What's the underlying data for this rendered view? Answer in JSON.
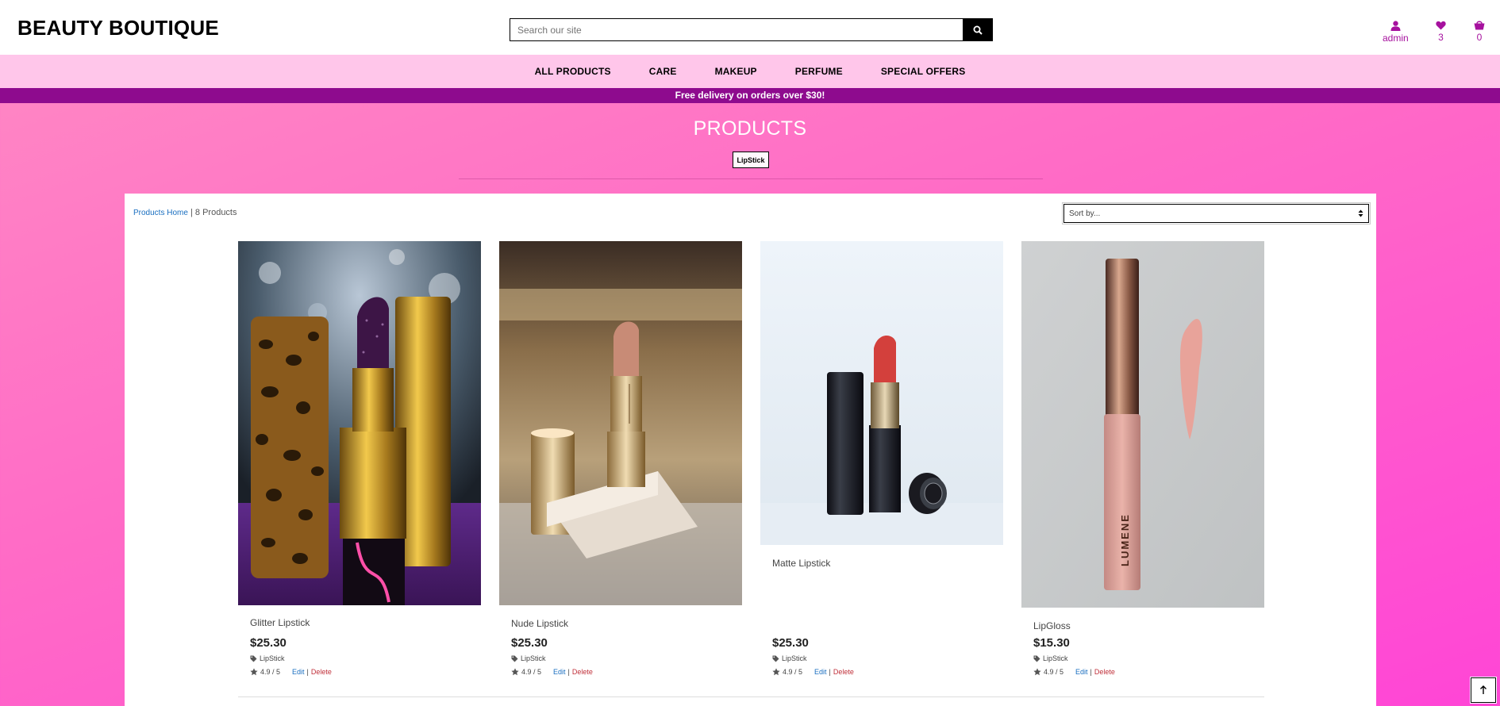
{
  "header": {
    "logo": "BEAUTY BOUTIQUE",
    "search_placeholder": "Search our site",
    "account_label": "admin",
    "wishlist_count": "3",
    "cart_count": "0"
  },
  "nav": {
    "items": [
      "ALL PRODUCTS",
      "CARE",
      "MAKEUP",
      "PERFUME",
      "SPECIAL OFFERS"
    ]
  },
  "banner": "Free delivery on orders over $30!",
  "page": {
    "title": "PRODUCTS",
    "category_badge": "LipStick"
  },
  "toolbar": {
    "breadcrumb_link": "Products Home",
    "separator": " | ",
    "product_count": "8 Products",
    "sort_placeholder": "Sort by..."
  },
  "products": [
    {
      "name": "Glitter Lipstick",
      "price": "$25.30",
      "category": "LipStick",
      "rating": "4.9 / 5",
      "edit": "Edit",
      "delete": "Delete"
    },
    {
      "name": "Nude Lipstick",
      "price": "$25.30",
      "category": "LipStick",
      "rating": "4.9 / 5",
      "edit": "Edit",
      "delete": "Delete"
    },
    {
      "name": "Matte Lipstick",
      "price": "$25.30",
      "category": "LipStick",
      "rating": "4.9 / 5",
      "edit": "Edit",
      "delete": "Delete"
    },
    {
      "name": "LipGloss",
      "price": "$15.30",
      "category": "LipStick",
      "rating": "4.9 / 5",
      "edit": "Edit",
      "delete": "Delete"
    }
  ],
  "colors": {
    "accent": "#a6119e",
    "nav_bg": "#ffc6ea",
    "banner_bg": "#8e0b8e",
    "link": "#1a6fc0",
    "delete": "#c0303a"
  },
  "icons": [
    "search-icon",
    "user-icon",
    "heart-icon",
    "cart-icon",
    "tag-icon",
    "star-icon",
    "sort-arrows-icon",
    "arrow-up-icon"
  ]
}
